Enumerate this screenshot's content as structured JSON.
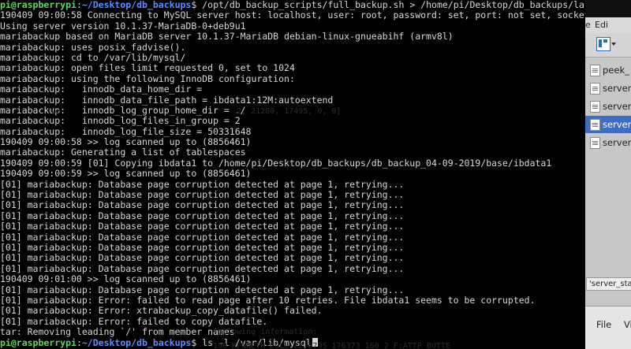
{
  "terminal": {
    "prompt1": {
      "user": "pi@raspberrypi",
      "path": "~/Desktop/db_backups",
      "command": "/opt/db_backup_scripts/full_backup.sh > /home/pi/Desktop/db_backups/last_backup.log"
    },
    "output": [
      "190409 09:00:58 Connecting to MySQL server host: localhost, user: root, password: set, port: not set, socket: not set",
      "Using server version 10.1.37-MariaDB-0+deb9u1",
      "mariabackup based on MariaDB server 10.1.37-MariaDB debian-linux-gnueabihf (armv8l)",
      "mariabackup: uses posix_fadvise().",
      "mariabackup: cd to /var/lib/mysql/",
      "mariabackup: open files limit requested 0, set to 1024",
      "mariabackup: using the following InnoDB configuration:",
      "mariabackup:   innodb_data_home_dir =",
      "mariabackup:   innodb_data_file_path = ibdata1:12M:autoextend",
      "mariabackup:   innodb_log_group_home_dir = ./",
      "mariabackup:   innodb_log_files_in_group = 2",
      "mariabackup:   innodb_log_file_size = 50331648",
      "190409 09:00:58 >> log scanned up to (8856461)",
      "mariabackup: Generating a list of tablespaces",
      "190409 09:00:59 [01] Copying ibdata1 to /home/pi/Desktop/db_backups/db_backup_04-09-2019/base/ibdata1",
      "190409 09:00:59 >> log scanned up to (8856461)",
      "[01] mariabackup: Database page corruption detected at page 1, retrying...",
      "[01] mariabackup: Database page corruption detected at page 1, retrying...",
      "[01] mariabackup: Database page corruption detected at page 1, retrying...",
      "[01] mariabackup: Database page corruption detected at page 1, retrying...",
      "[01] mariabackup: Database page corruption detected at page 1, retrying...",
      "[01] mariabackup: Database page corruption detected at page 1, retrying...",
      "[01] mariabackup: Database page corruption detected at page 1, retrying...",
      "[01] mariabackup: Database page corruption detected at page 1, retrying...",
      "[01] mariabackup: Database page corruption detected at page 1, retrying...",
      "190409 09:01:00 >> log scanned up to (8856461)",
      "[01] mariabackup: Database page corruption detected at page 1, retrying...",
      "[01] mariabackup: Error: failed to read page after 10 retries. File ibdata1 seems to be corrupted.",
      "[01] mariabackup: Error: xtrabackup_copy_datafile() failed.",
      "[01] mariabackup: Error: failed to copy datafile.",
      "tar: Removing leading `/' from member names"
    ],
    "prompt2": {
      "user": "pi@raspberrypi",
      "path": "~/Desktop/db_backups",
      "command": "ls -l /var/lib/mysql"
    },
    "prompt_separator": ":",
    "prompt_symbol": "$",
    "ghost_text": [
      "ve",
      "2, 21280, 17495, 0, 0]",
      "following information:",
      "190 KENNETH DOLL 22:0795 176373 160 2 F:ATTP BUTTE"
    ]
  },
  "background_window": {
    "menu": [
      "e",
      "Edi"
    ],
    "files": [
      {
        "label": "peek_"
      },
      {
        "label": "server"
      },
      {
        "label": "server"
      },
      {
        "label": "server",
        "selected": true
      },
      {
        "label": "server"
      }
    ],
    "tag": "'server_sta",
    "dialog_menu": [
      "File",
      "View"
    ]
  }
}
